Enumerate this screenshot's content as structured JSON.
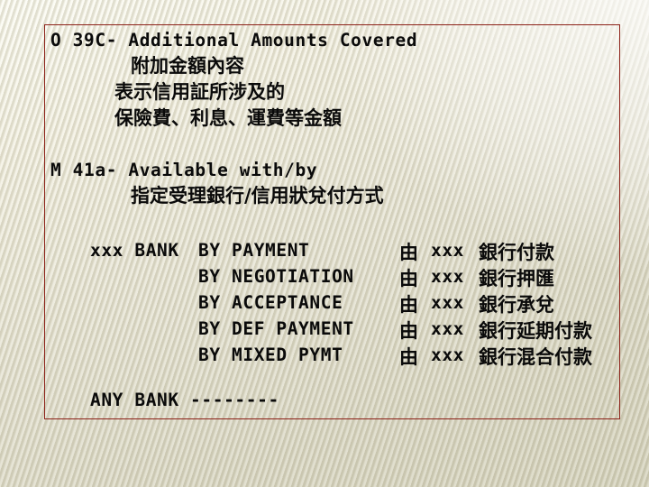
{
  "slide": {
    "background_color": "#e9e7da",
    "frame_color": "#8c2118",
    "text_color": "#0a0a0a"
  },
  "block_39c": {
    "english": "O 39C- Additional Amounts Covered",
    "chinese_1": "附加金額內容",
    "chinese_2": "表示信用証所涉及的",
    "chinese_3": "保險費、利息、運費等金額"
  },
  "block_41a": {
    "english": "M 41a- Available with/by",
    "chinese_1": "指定受理銀行/信用狀兌付方式"
  },
  "table": {
    "rows": [
      {
        "bank": "xxx BANK",
        "mode": "BY PAYMENT",
        "by_word": "由",
        "bank_cn_placeholder": "xxx",
        "chinese": "銀行付款"
      },
      {
        "bank": "",
        "mode": "BY NEGOTIATION",
        "by_word": "由",
        "bank_cn_placeholder": "xxx",
        "chinese": "銀行押匯"
      },
      {
        "bank": "",
        "mode": "BY ACCEPTANCE",
        "by_word": "由",
        "bank_cn_placeholder": "xxx",
        "chinese": "銀行承兌"
      },
      {
        "bank": "",
        "mode": "BY DEF PAYMENT",
        "by_word": "由",
        "bank_cn_placeholder": "xxx",
        "chinese": "銀行延期付款"
      },
      {
        "bank": "",
        "mode": "BY MIXED PYMT",
        "by_word": "由",
        "bank_cn_placeholder": "xxx",
        "chinese": "銀行混合付款"
      }
    ],
    "footer": "ANY BANK --------"
  }
}
